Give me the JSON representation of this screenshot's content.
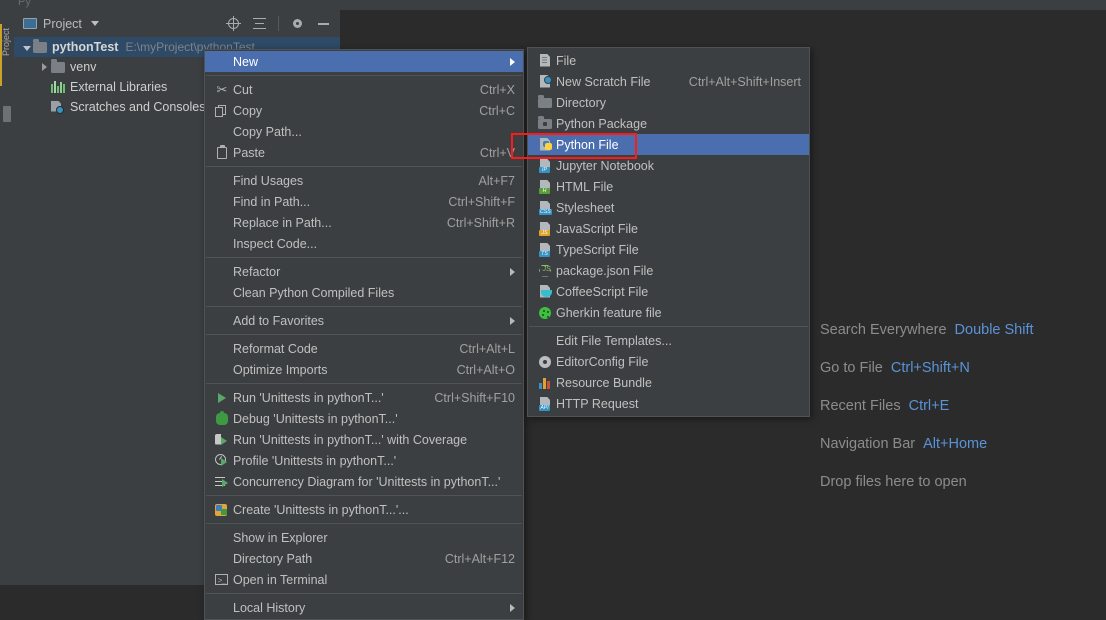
{
  "window": {
    "background": "#2b2b2b",
    "panel_background": "#3c3f41",
    "selection_blue": "#4b6eaf",
    "tree_selection": "#2f4a66",
    "annotation_color": "#ff1a1a",
    "top_ghost": "Py"
  },
  "left_strip": {
    "tab_label": "Project"
  },
  "project_tool_window": {
    "title": "Project",
    "toolbar_icons": [
      {
        "name": "locate-icon",
        "glyph": "target"
      },
      {
        "name": "collapse-all-icon",
        "glyph": "collapse"
      },
      {
        "name": "settings-icon",
        "glyph": "gear"
      },
      {
        "name": "hide-icon",
        "glyph": "minimize"
      }
    ],
    "tree": [
      {
        "label": "pythonTest",
        "path": "E:\\myProject\\pythonTest",
        "icon": "folder-icon",
        "expanded": true,
        "selected": true,
        "depth": 0,
        "bold": true
      },
      {
        "label": "venv",
        "path": "",
        "icon": "folder-icon",
        "expanded": false,
        "selected": false,
        "depth": 1,
        "bold": false
      },
      {
        "label": "External Libraries",
        "path": "",
        "icon": "library-icon",
        "expanded": null,
        "selected": false,
        "depth": 1,
        "bold": false
      },
      {
        "label": "Scratches and Consoles",
        "path": "",
        "icon": "scratches-icon",
        "expanded": null,
        "selected": false,
        "depth": 1,
        "bold": false
      }
    ]
  },
  "context_menu": {
    "items": [
      {
        "label": "New",
        "accel": "",
        "icon": "",
        "submenu": true,
        "highlighted": true
      },
      {
        "type": "separator"
      },
      {
        "label": "Cut",
        "accel": "Ctrl+X",
        "icon": "scissors-icon",
        "submenu": false
      },
      {
        "label": "Copy",
        "accel": "Ctrl+C",
        "icon": "copy-icon",
        "submenu": false
      },
      {
        "label": "Copy Path...",
        "accel": "",
        "icon": "",
        "submenu": false
      },
      {
        "label": "Paste",
        "accel": "Ctrl+V",
        "icon": "paste-icon",
        "submenu": false
      },
      {
        "type": "separator"
      },
      {
        "label": "Find Usages",
        "accel": "Alt+F7",
        "icon": "",
        "submenu": false
      },
      {
        "label": "Find in Path...",
        "accel": "Ctrl+Shift+F",
        "icon": "",
        "submenu": false
      },
      {
        "label": "Replace in Path...",
        "accel": "Ctrl+Shift+R",
        "icon": "",
        "submenu": false
      },
      {
        "label": "Inspect Code...",
        "accel": "",
        "icon": "",
        "submenu": false
      },
      {
        "type": "separator"
      },
      {
        "label": "Refactor",
        "accel": "",
        "icon": "",
        "submenu": true
      },
      {
        "label": "Clean Python Compiled Files",
        "accel": "",
        "icon": "",
        "submenu": false
      },
      {
        "type": "separator"
      },
      {
        "label": "Add to Favorites",
        "accel": "",
        "icon": "",
        "submenu": true
      },
      {
        "type": "separator"
      },
      {
        "label": "Reformat Code",
        "accel": "Ctrl+Alt+L",
        "icon": "",
        "submenu": false
      },
      {
        "label": "Optimize Imports",
        "accel": "Ctrl+Alt+O",
        "icon": "",
        "submenu": false
      },
      {
        "type": "separator"
      },
      {
        "label": "Run 'Unittests in pythonT...'",
        "accel": "Ctrl+Shift+F10",
        "icon": "run-icon",
        "submenu": false
      },
      {
        "label": "Debug 'Unittests in pythonT...'",
        "accel": "",
        "icon": "debug-icon",
        "submenu": false
      },
      {
        "label": "Run 'Unittests in pythonT...' with Coverage",
        "accel": "",
        "icon": "coverage-icon",
        "submenu": false
      },
      {
        "label": "Profile 'Unittests in pythonT...'",
        "accel": "",
        "icon": "profile-icon",
        "submenu": false
      },
      {
        "label": "Concurrency Diagram for 'Unittests in pythonT...'",
        "accel": "",
        "icon": "concurrency-icon",
        "submenu": false
      },
      {
        "type": "separator"
      },
      {
        "label": "Create 'Unittests in pythonT...'...",
        "accel": "",
        "icon": "create-config-icon",
        "submenu": false
      },
      {
        "type": "separator"
      },
      {
        "label": "Show in Explorer",
        "accel": "",
        "icon": "",
        "submenu": false
      },
      {
        "label": "Directory Path",
        "accel": "Ctrl+Alt+F12",
        "icon": "",
        "submenu": false
      },
      {
        "label": "Open in Terminal",
        "accel": "",
        "icon": "terminal-icon",
        "submenu": false
      },
      {
        "type": "separator"
      },
      {
        "label": "Local History",
        "accel": "",
        "icon": "",
        "submenu": true
      }
    ]
  },
  "new_submenu": {
    "items": [
      {
        "label": "File",
        "accel": "",
        "icon": "file-icon",
        "highlighted": false
      },
      {
        "label": "New Scratch File",
        "accel": "Ctrl+Alt+Shift+Insert",
        "icon": "scratch-file-icon",
        "highlighted": false
      },
      {
        "label": "Directory",
        "accel": "",
        "icon": "directory-icon",
        "highlighted": false
      },
      {
        "label": "Python Package",
        "accel": "",
        "icon": "python-package-icon",
        "highlighted": false
      },
      {
        "label": "Python File",
        "accel": "",
        "icon": "python-file-icon",
        "highlighted": true
      },
      {
        "label": "Jupyter Notebook",
        "accel": "",
        "icon": "jupyter-icon",
        "highlighted": false
      },
      {
        "label": "HTML File",
        "accel": "",
        "icon": "html-icon",
        "highlighted": false
      },
      {
        "label": "Stylesheet",
        "accel": "",
        "icon": "css-icon",
        "highlighted": false
      },
      {
        "label": "JavaScript File",
        "accel": "",
        "icon": "js-icon",
        "highlighted": false
      },
      {
        "label": "TypeScript File",
        "accel": "",
        "icon": "ts-icon",
        "highlighted": false
      },
      {
        "label": "package.json File",
        "accel": "",
        "icon": "packagejson-icon",
        "highlighted": false
      },
      {
        "label": "CoffeeScript File",
        "accel": "",
        "icon": "coffeescript-icon",
        "highlighted": false
      },
      {
        "label": "Gherkin feature file",
        "accel": "",
        "icon": "gherkin-icon",
        "highlighted": false
      },
      {
        "type": "separator"
      },
      {
        "label": "Edit File Templates...",
        "accel": "",
        "icon": "",
        "highlighted": false
      },
      {
        "label": "EditorConfig File",
        "accel": "",
        "icon": "editorconfig-icon",
        "highlighted": false
      },
      {
        "label": "Resource Bundle",
        "accel": "",
        "icon": "resource-bundle-icon",
        "highlighted": false
      },
      {
        "label": "HTTP Request",
        "accel": "",
        "icon": "http-request-icon",
        "highlighted": false
      }
    ]
  },
  "editor_hints": [
    {
      "name": "Search Everywhere",
      "key": "Double Shift"
    },
    {
      "name": "Go to File",
      "key": "Ctrl+Shift+N"
    },
    {
      "name": "Recent Files",
      "key": "Ctrl+E"
    },
    {
      "name": "Navigation Bar",
      "key": "Alt+Home"
    },
    {
      "name": "Drop files here to open",
      "key": ""
    }
  ]
}
